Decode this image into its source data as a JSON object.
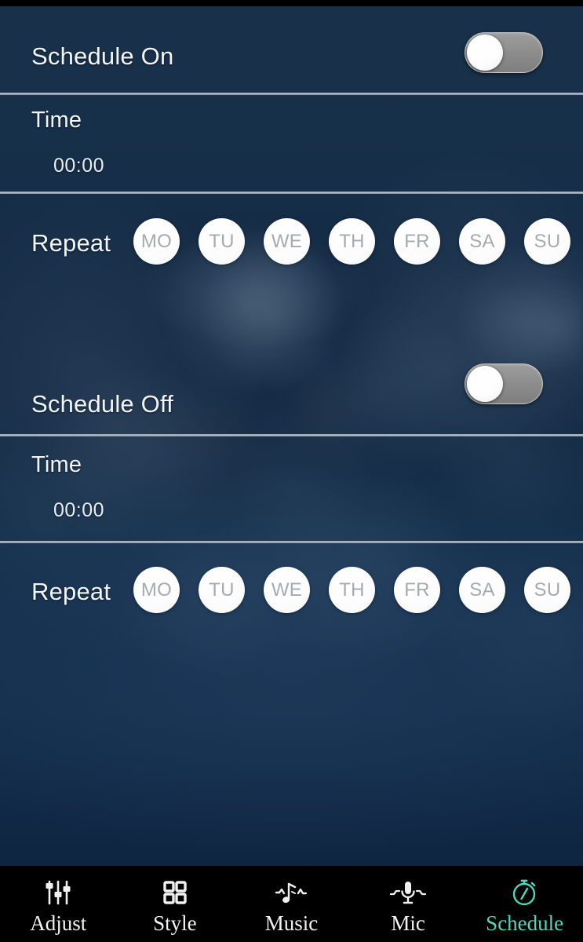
{
  "screen": {
    "active_tab": "Schedule",
    "accent_color": "#4fd6bc",
    "background_color": "#142a44",
    "divider_color": "#a8b2bd"
  },
  "schedule_on": {
    "label": "Schedule On",
    "toggle_state": "off",
    "time": {
      "label": "Time",
      "value": "00:00"
    },
    "repeat": {
      "label": "Repeat",
      "days": [
        {
          "code": "MO",
          "selected": false
        },
        {
          "code": "TU",
          "selected": false
        },
        {
          "code": "WE",
          "selected": false
        },
        {
          "code": "TH",
          "selected": false
        },
        {
          "code": "FR",
          "selected": false
        },
        {
          "code": "SA",
          "selected": false
        },
        {
          "code": "SU",
          "selected": false
        }
      ]
    }
  },
  "schedule_off": {
    "label": "Schedule Off",
    "toggle_state": "off",
    "time": {
      "label": "Time",
      "value": "00:00"
    },
    "repeat": {
      "label": "Repeat",
      "days": [
        {
          "code": "MO",
          "selected": false
        },
        {
          "code": "TU",
          "selected": false
        },
        {
          "code": "WE",
          "selected": false
        },
        {
          "code": "TH",
          "selected": false
        },
        {
          "code": "FR",
          "selected": false
        },
        {
          "code": "SA",
          "selected": false
        },
        {
          "code": "SU",
          "selected": false
        }
      ]
    }
  },
  "navbar": {
    "items": [
      {
        "label": "Adjust",
        "icon": "sliders-icon",
        "active": false
      },
      {
        "label": "Style",
        "icon": "grid-icon",
        "active": false
      },
      {
        "label": "Music",
        "icon": "music-note-icon",
        "active": false
      },
      {
        "label": "Mic",
        "icon": "microphone-icon",
        "active": false
      },
      {
        "label": "Schedule",
        "icon": "stopwatch-icon",
        "active": true
      }
    ]
  }
}
